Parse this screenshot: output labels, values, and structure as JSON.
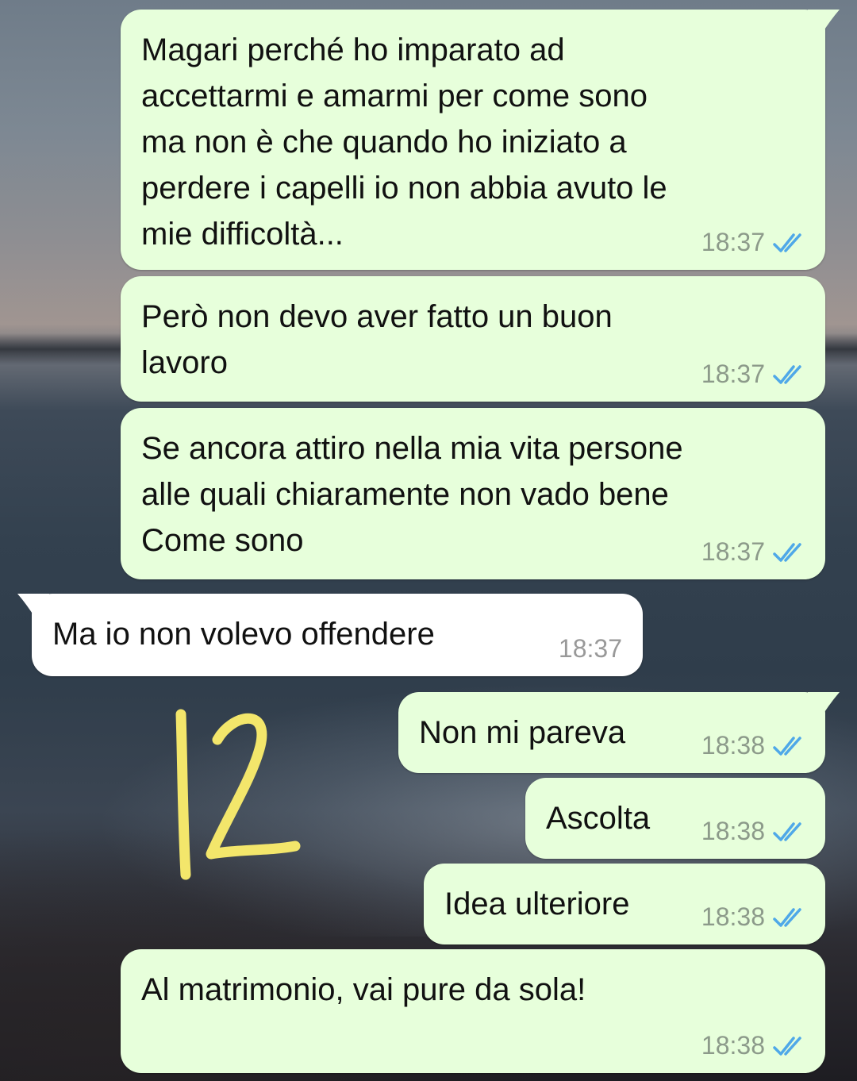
{
  "theme": {
    "outgoing_bubble": "#e7ffdb",
    "incoming_bubble": "#ffffff",
    "read_tick_color": "#4fa8e8",
    "annotation_color": "#f3e66b"
  },
  "messages": [
    {
      "direction": "outgoing",
      "text": "Magari perché ho imparato ad\naccettarmi e amarmi per come sono\nma non è che quando ho iniziato a\nperdere i capelli io non abbia avuto le\nmie difficoltà...",
      "time": "18:37",
      "status_icon": "double-check-read-icon"
    },
    {
      "direction": "outgoing",
      "text": "Però non devo aver fatto un buon\nlavoro",
      "time": "18:37",
      "status_icon": "double-check-read-icon"
    },
    {
      "direction": "outgoing",
      "text": "Se ancora attiro nella mia vita persone\nalle quali chiaramente non vado bene\nCome sono",
      "time": "18:37",
      "status_icon": "double-check-read-icon"
    },
    {
      "direction": "incoming",
      "text": "Ma io non volevo offendere",
      "time": "18:37"
    },
    {
      "direction": "outgoing",
      "text": "Non mi pareva",
      "time": "18:38",
      "status_icon": "double-check-read-icon"
    },
    {
      "direction": "outgoing",
      "text": "Ascolta",
      "time": "18:38",
      "status_icon": "double-check-read-icon"
    },
    {
      "direction": "outgoing",
      "text": "Idea ulteriore",
      "time": "18:38",
      "status_icon": "double-check-read-icon"
    },
    {
      "direction": "outgoing",
      "text": "Al matrimonio, vai pure da sola!",
      "time": "18:38",
      "status_icon": "double-check-read-icon"
    }
  ],
  "annotation": {
    "text": "12"
  }
}
